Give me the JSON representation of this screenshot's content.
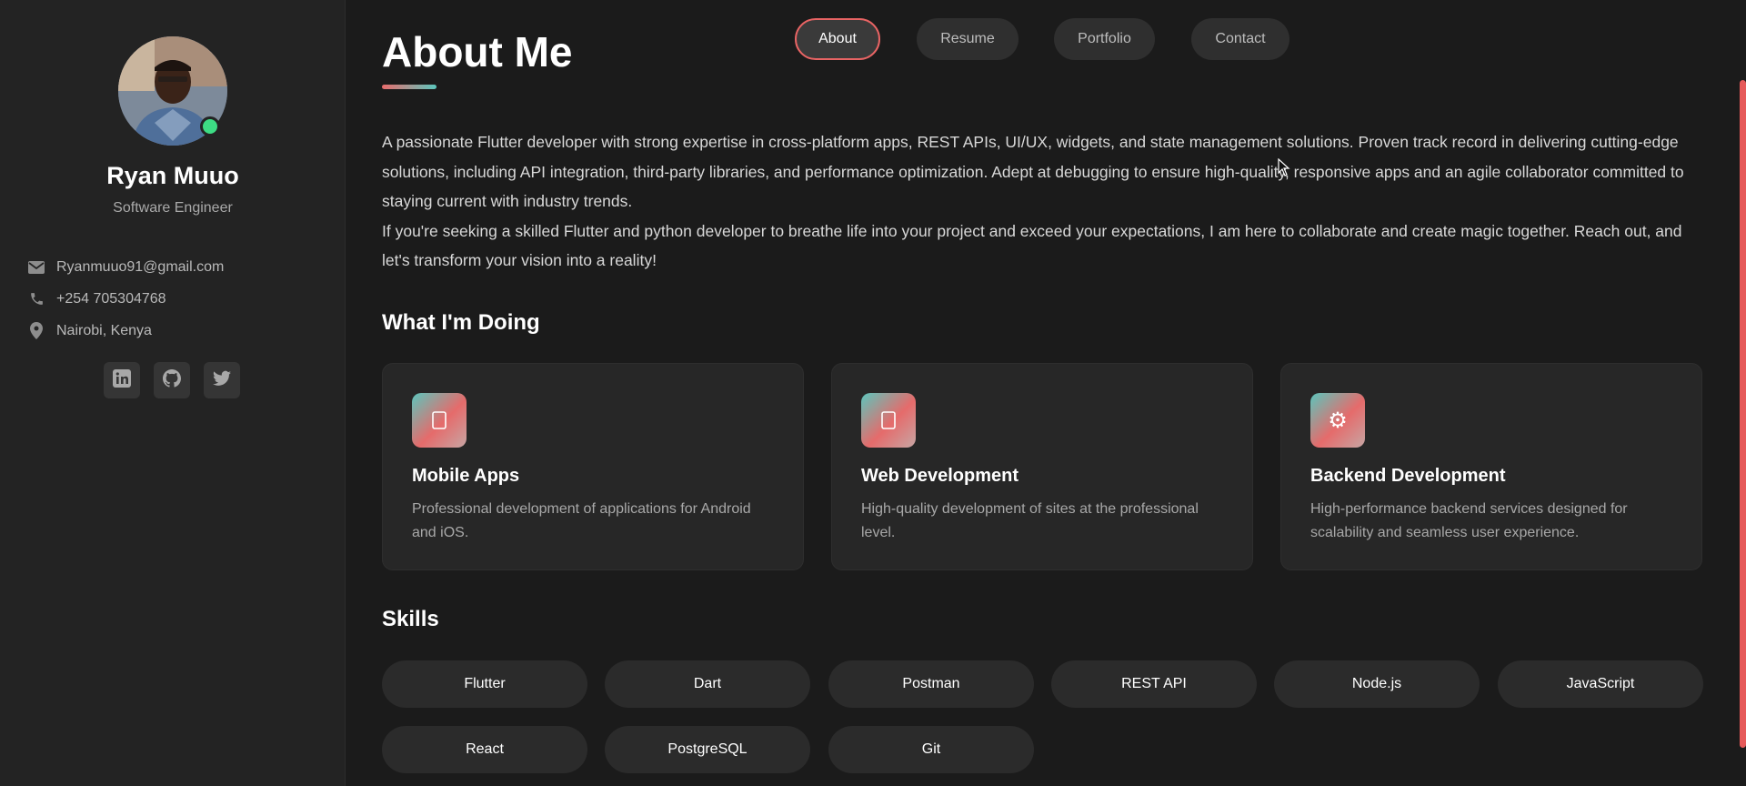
{
  "profile": {
    "name": "Ryan Muuo",
    "role": "Software Engineer",
    "status": "online",
    "avatar_icon": "profile-photo"
  },
  "contacts": [
    {
      "icon": "mail-icon",
      "text": "Ryanmuuo91@gmail.com"
    },
    {
      "icon": "phone-icon",
      "text": "+254 705304768"
    },
    {
      "icon": "location-pin-icon",
      "text": "Nairobi, Kenya"
    }
  ],
  "socials": [
    {
      "name": "linkedin-icon"
    },
    {
      "name": "github-icon"
    },
    {
      "name": "twitter-icon"
    }
  ],
  "nav": [
    {
      "label": "About",
      "active": true
    },
    {
      "label": "Resume",
      "active": false
    },
    {
      "label": "Portfolio",
      "active": false
    },
    {
      "label": "Contact",
      "active": false
    }
  ],
  "about": {
    "title": "About Me",
    "paragraph1": "A passionate Flutter developer with strong expertise in cross-platform apps, REST APIs, UI/UX, widgets, and state management solutions. Proven track record in delivering cutting-edge solutions, including API integration, third-party libraries, and performance optimization. Adept at debugging to ensure high-quality, responsive apps and an agile collaborator committed to staying current with industry trends.",
    "paragraph2": "If you're seeking a skilled Flutter and python developer to breathe life into your project and exceed your expectations, I am here to collaborate and create magic together. Reach out, and let's transform your vision into a reality!"
  },
  "doing": {
    "title": "What I'm Doing",
    "cards": [
      {
        "icon": "mobile-icon",
        "title": "Mobile Apps",
        "desc": "Professional development of applications for Android and iOS."
      },
      {
        "icon": "web-icon",
        "title": "Web Development",
        "desc": "High-quality development of sites at the professional level."
      },
      {
        "icon": "gear-icon",
        "glyph": "⚙",
        "title": "Backend Development",
        "desc": "High-performance backend services designed for scalability and seamless user experience."
      }
    ]
  },
  "skills": {
    "title": "Skills",
    "items": [
      "Flutter",
      "Dart",
      "Postman",
      "REST API",
      "Node.js",
      "JavaScript",
      "React",
      "PostgreSQL",
      "Git"
    ]
  },
  "colors": {
    "accent": "#e86464",
    "teal": "#5bc6bd",
    "online": "#3ddc84",
    "background": "#1b1b1b",
    "sidebar": "#232323"
  }
}
